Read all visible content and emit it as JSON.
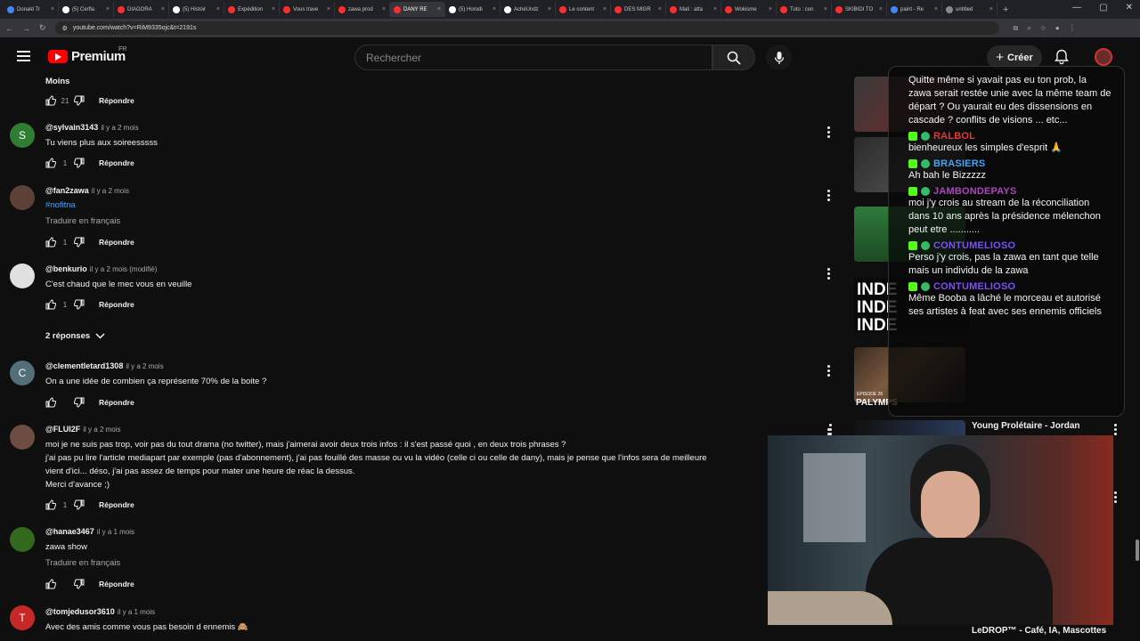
{
  "browser": {
    "tabs": [
      {
        "label": "Donald Tr",
        "color": "#4285f4"
      },
      {
        "label": "(5) Cerfla",
        "color": "#ffffff"
      },
      {
        "label": "DIAGORA",
        "color": "#ff2d2d"
      },
      {
        "label": "(5) Histoir",
        "color": "#ffffff"
      },
      {
        "label": "Expédition",
        "color": "#ff2d2d"
      },
      {
        "label": "Vous trave",
        "color": "#ff2d2d"
      },
      {
        "label": "zawa prod",
        "color": "#ff2d2d"
      },
      {
        "label": "DANY RE",
        "color": "#ff2d2d",
        "active": true
      },
      {
        "label": "(5) Horodi",
        "color": "#ffffff"
      },
      {
        "label": "AchéUndz",
        "color": "#ffffff"
      },
      {
        "label": "Le content",
        "color": "#ff2d2d"
      },
      {
        "label": "DES MIGR",
        "color": "#ff2d2d"
      },
      {
        "label": "Mali : atta",
        "color": "#ff2d2d"
      },
      {
        "label": "Wokisme",
        "color": "#ff2d2d"
      },
      {
        "label": "Tuto : con",
        "color": "#ff2d2d"
      },
      {
        "label": "SKIBIDI TO",
        "color": "#ff2d2d"
      },
      {
        "label": "paint - Re",
        "color": "#4285f4"
      },
      {
        "label": "untitled",
        "color": "#888888"
      }
    ],
    "url": "youtube.com/watch?v=RiM9335ojc&t=2191s"
  },
  "header": {
    "brand": "Premium",
    "region": "FR",
    "search_placeholder": "Rechercher",
    "create_label": "Créer"
  },
  "comments": [
    {
      "more_label": "Moins",
      "likes": "21",
      "reply": "Répondre"
    },
    {
      "handle": "@sylvain3143",
      "time": "il y a 2 mois",
      "text": "Tu viens plus aux soireesssss",
      "likes": "1",
      "reply": "Répondre",
      "avatar_letter": "S",
      "avatar_color": "#2e7d32"
    },
    {
      "handle": "@fan2zawa",
      "time": "il y a 2 mois",
      "hashtag": "#nofitna",
      "translate": "Traduire en français",
      "likes": "1",
      "reply": "Répondre"
    },
    {
      "handle": "@benkurio",
      "time": "il y a 2 mois (modifié)",
      "text": "C'est chaud que le mec vous en veuille",
      "likes": "1",
      "reply": "Répondre",
      "replies_label": "2 réponses"
    },
    {
      "handle": "@clementletard1308",
      "time": "il y a 2 mois",
      "text": "On a une idée de combien ça représente 70% de la boite ?",
      "reply": "Répondre",
      "avatar_letter": "C",
      "avatar_color": "#546e7a"
    },
    {
      "handle": "@FLUI2F",
      "time": "il y a 2 mois",
      "lines": [
        "moi je ne suis pas trop, voir pas du tout drama (no twitter), mais j'aimerai avoir deux trois infos : il s'est passé quoi , en deux trois phrases ?",
        "j'ai pas pu lire l'article mediapart par exemple (pas d'abonnement), j'ai pas fouillé des masse ou vu la vidéo (celle ci ou celle de dany), mais je pense que l'infos sera de meilleure",
        "vient d'ici... déso, j'ai pas assez de temps pour mater une heure de réac la dessus.",
        "Merci d'avance ;)"
      ],
      "likes": "1",
      "reply": "Répondre"
    },
    {
      "handle": "@hanae3467",
      "time": "il y a 1 mois",
      "text": "zawa show",
      "translate": "Traduire en français",
      "reply": "Répondre"
    },
    {
      "handle": "@tomjedusor3610",
      "time": "il y a 1 mois",
      "text": "Avec des amis comme vous pas besoin d ennemis 🙈",
      "avatar_letter": "T",
      "avatar_color": "#c62828"
    }
  ],
  "chat": [
    {
      "user": "",
      "user_color": "#ffffff",
      "text": "Quitte même si yavait pas eu ton prob, la zawa serait restée unie avec la même team de départ ? Ou yaurait eu des dissensions en cascade ? conflits de visions ... etc..."
    },
    {
      "user": "RALBOL",
      "user_color": "#e53935",
      "text": "bienheureux les simples d'esprit 🙏"
    },
    {
      "user": "BRASIERS",
      "user_color": "#42a5f5",
      "text": "Ah bah le Bizzzzz"
    },
    {
      "user": "JAMBONDEPAYS",
      "user_color": "#ab47bc",
      "text": "moi j'y crois au stream de la réconciliation dans 10 ans après la présidence mélenchon peut etre ..........."
    },
    {
      "user": "CONTUMELIOSO",
      "user_color": "#7c4dff",
      "text": "Perso j'y crois, pas la zawa en tant que telle mais un individu de la zawa"
    },
    {
      "user": "CONTUMELIOSO",
      "user_color": "#7c4dff",
      "text": "Même Booba a lâché le morceau et autorisé ses artistes à feat avec ses ennemis officiels"
    }
  ],
  "sidebar": {
    "video1_title": "Young Prolétaire - Jordan",
    "video2_title": "LeDROP™ - Café, IA, Mascottes",
    "thumb_text_1": "INDE",
    "thumb_text_2": "EPISODE 26",
    "thumb_text_3": "PALYMPS"
  }
}
